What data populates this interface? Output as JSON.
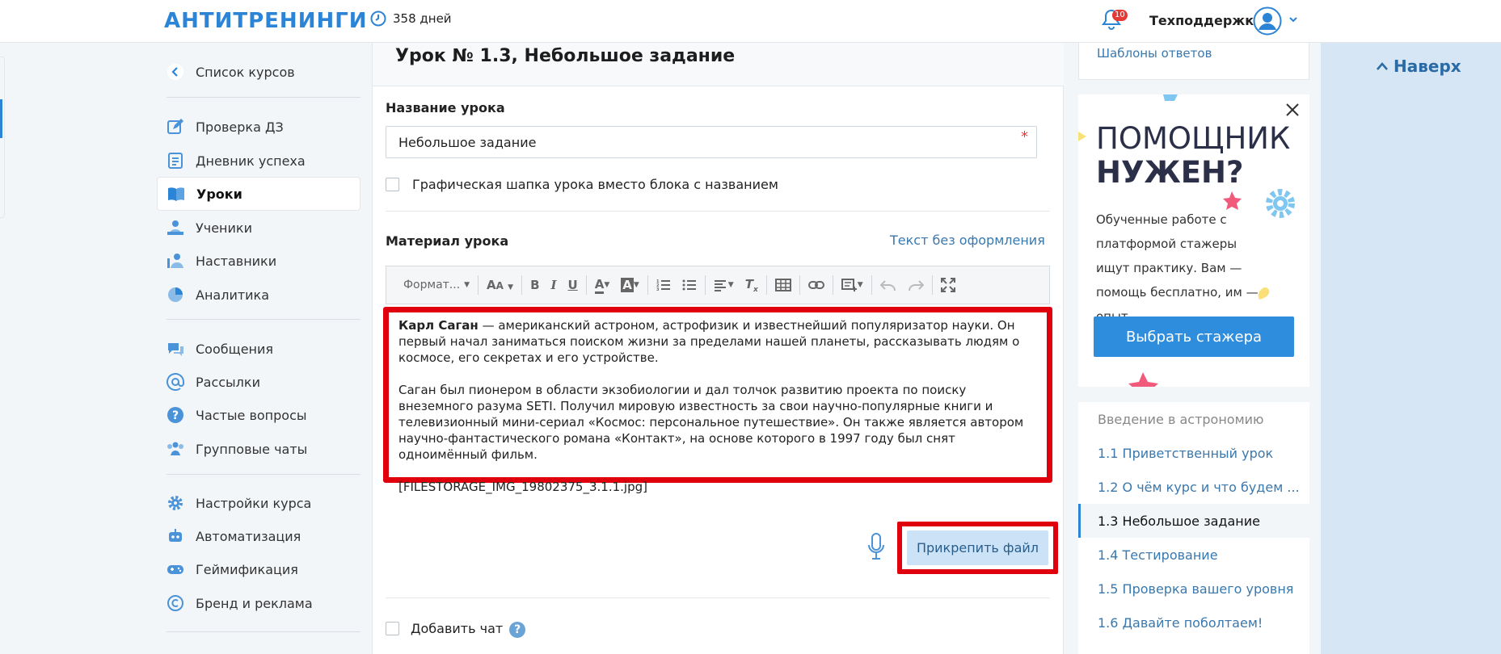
{
  "header": {
    "logo": "АНТИТРЕНИНГИ",
    "days": "358 дней",
    "notifications_count": "10",
    "support": "Техподдержка"
  },
  "sidebar": {
    "items": [
      {
        "label": "Список курсов",
        "icon": "chevron-left-icon"
      },
      {
        "label": "Проверка ДЗ",
        "icon": "edit-icon"
      },
      {
        "label": "Дневник успеха",
        "icon": "diary-icon"
      },
      {
        "label": "Уроки",
        "icon": "book-icon",
        "active": true
      },
      {
        "label": "Ученики",
        "icon": "students-icon"
      },
      {
        "label": "Наставники",
        "icon": "mentors-icon"
      },
      {
        "label": "Аналитика",
        "icon": "pie-chart-icon"
      },
      {
        "label": "Сообщения",
        "icon": "messages-icon"
      },
      {
        "label": "Рассылки",
        "icon": "at-icon"
      },
      {
        "label": "Частые вопросы",
        "icon": "question-icon"
      },
      {
        "label": "Групповые чаты",
        "icon": "group-icon"
      },
      {
        "label": "Настройки курса",
        "icon": "gear-icon"
      },
      {
        "label": "Автоматизация",
        "icon": "robot-icon"
      },
      {
        "label": "Геймификация",
        "icon": "gamepad-icon"
      },
      {
        "label": "Бренд и реклама",
        "icon": "copyright-icon"
      }
    ]
  },
  "lesson": {
    "title": "Урок № 1.3, Небольшое задание",
    "name_label": "Название урока",
    "name_value": "Небольшое задание",
    "required_mark": "*",
    "header_checkbox_label": "Графическая шапка урока вместо блока с названием",
    "material_label": "Материал урока",
    "plain_text_link": "Текст без оформления",
    "toolbar_format": "Формат...",
    "editor": {
      "p1_bold": "Карл Саган",
      "p1_rest": " — американский астроном, астрофизик и известнейший популяризатор науки. Он первый начал заниматься поиском жизни за пределами нашей планеты, рассказывать людям о космосе, его секретах и его устройстве.",
      "p2": "Саган был пионером в области экзобиологии и дал толчок развитию проекта по поиску внеземного разума SETI. Получил мировую известность за свои научно-популярные книги и телевизионный мини-сериал «Космос: персональное путешествие». Он также является автором научно-фантастического романа «Контакт», на основе которого в 1997 году был снят одноимённый фильм.",
      "p3": "[FILESTORAGE_IMG_19802375_3.1.1.jpg]"
    },
    "attach_button": "Прикрепить файл",
    "add_chat_label": "Добавить чат"
  },
  "right": {
    "templates_link": "Шаблоны ответов",
    "promo": {
      "headline1": "ПОМОЩНИК",
      "headline2": "НУЖЕН?",
      "text": "Обученные работе с платформой стажеры ищут практику. Вам — помощь бесплатно, им — опыт.",
      "button": "Выбрать стажера"
    },
    "lessons": [
      {
        "label": "Введение в астрономию",
        "type": "head"
      },
      {
        "label": "1.1 Приветственный урок"
      },
      {
        "label": "1.2 О чём курс и что будем ..."
      },
      {
        "label": "1.3 Небольшое задание",
        "current": true
      },
      {
        "label": "1.4 Тестирование"
      },
      {
        "label": "1.5 Проверка вашего уровня"
      },
      {
        "label": "1.6 Давайте поболтаем!"
      }
    ]
  },
  "scroll_top": "Наверх"
}
